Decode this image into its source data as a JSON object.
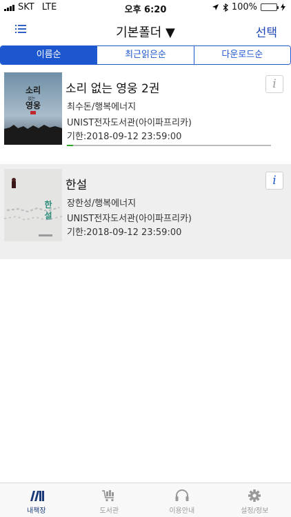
{
  "status_bar": {
    "carrier": "SKT",
    "network": "LTE",
    "time": "오후 6:20",
    "battery_percent": "100%"
  },
  "nav": {
    "title": "기본폴더 ▼",
    "select_label": "선택"
  },
  "sort_tabs": [
    {
      "label": "이름순",
      "active": true
    },
    {
      "label": "최근읽은순",
      "active": false
    },
    {
      "label": "다운로드순",
      "active": false
    }
  ],
  "books": [
    {
      "title": "소리 없는 영웅 2권",
      "author": "최수돈/행복에너지",
      "library": "UNIST전자도서관(아이파프리카)",
      "due": "기한:2018-09-12 23:59:00",
      "progress_fraction": 0.03,
      "cover_title": "소리 없는 영웅"
    },
    {
      "title": "한설",
      "author": "장한성/행복에너지",
      "library": "UNIST전자도서관(아이파프리카)",
      "due": "기한:2018-09-12 23:59:00",
      "cover_title": "한설"
    }
  ],
  "tabbar": [
    {
      "label": "내책장",
      "icon": "books-icon",
      "active": true
    },
    {
      "label": "도서관",
      "icon": "cart-icon",
      "active": false
    },
    {
      "label": "이용안내",
      "icon": "headset-icon",
      "active": false
    },
    {
      "label": "설정/정보",
      "icon": "gear-icon",
      "active": false
    }
  ],
  "colors": {
    "accent": "#1c57d0",
    "progress": "#2aa82a",
    "battery": "#2ac12a"
  }
}
